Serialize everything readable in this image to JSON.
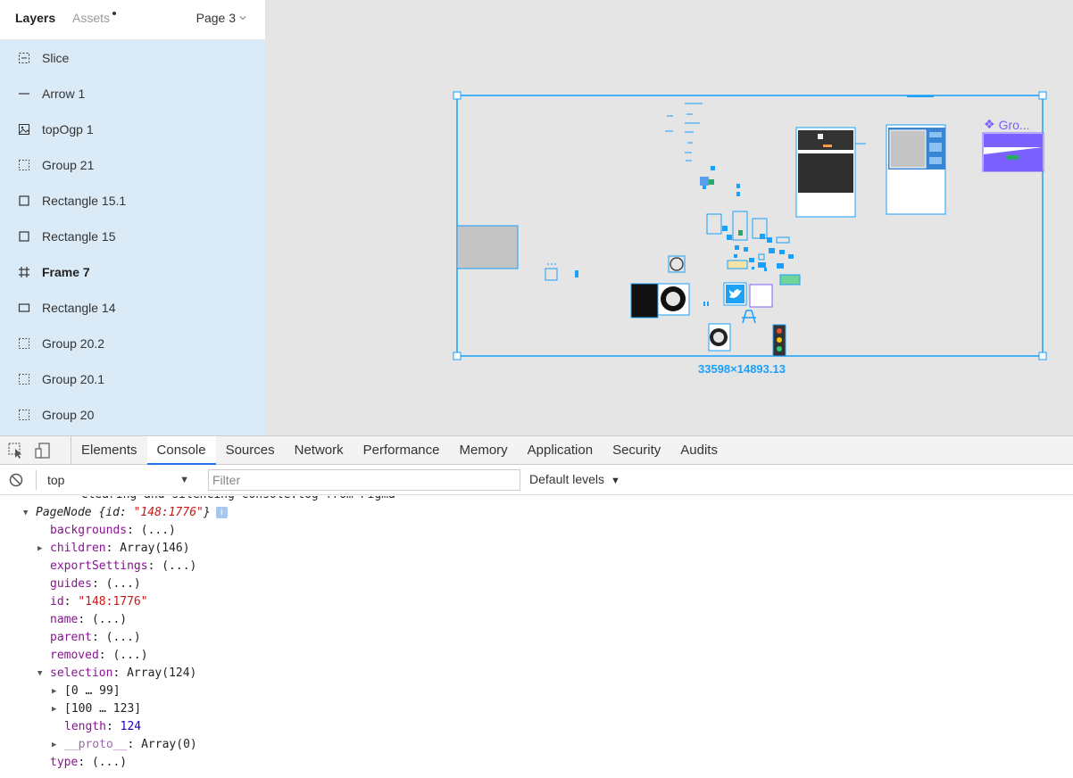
{
  "figma": {
    "tabs": {
      "layers": "Layers",
      "assets": "Assets"
    },
    "page_selector": "Page 3",
    "layers": [
      {
        "name": "Slice",
        "icon": "slice-icon",
        "kind": "slice"
      },
      {
        "name": "Arrow 1",
        "icon": "line-icon",
        "kind": "line"
      },
      {
        "name": "topOgp 1",
        "icon": "image-icon",
        "kind": "image"
      },
      {
        "name": "Group 21",
        "icon": "group-icon",
        "kind": "group"
      },
      {
        "name": "Rectangle 15.1",
        "icon": "rectangle-icon",
        "kind": "rect"
      },
      {
        "name": "Rectangle 15",
        "icon": "rectangle-icon",
        "kind": "rect"
      },
      {
        "name": "Frame 7",
        "icon": "frame-icon",
        "kind": "frame"
      },
      {
        "name": "Rectangle 14",
        "icon": "rectangle-icon",
        "kind": "rect-wide"
      },
      {
        "name": "Group 20.2",
        "icon": "group-icon",
        "kind": "group"
      },
      {
        "name": "Group 20.1",
        "icon": "group-icon",
        "kind": "group"
      },
      {
        "name": "Group 20",
        "icon": "group-icon",
        "kind": "group"
      }
    ],
    "canvas": {
      "dimension_label": "33598×14893.13",
      "group_label": "Gro..."
    },
    "colors": {
      "selection": "#18a0fb",
      "component": "#7b61ff",
      "layer_list_bg": "#daeaf7"
    }
  },
  "devtools": {
    "tabs": [
      "Elements",
      "Console",
      "Sources",
      "Network",
      "Performance",
      "Memory",
      "Application",
      "Security",
      "Audits"
    ],
    "active_tab": "Console",
    "context": "top",
    "filter_placeholder": "Filter",
    "levels": "Default levels",
    "console": {
      "clipped_line": "------- Clearing and silencing console.log from Figma -------",
      "root_label": "PageNode",
      "root_id_key": "id",
      "root_id_value": "\"148:1776\"",
      "info_badge": "i",
      "props": [
        {
          "key": "backgrounds",
          "value": "(...)",
          "expandable": false,
          "expanded": false
        },
        {
          "key": "children",
          "value": "Array(146)",
          "expandable": true,
          "expanded": false
        },
        {
          "key": "exportSettings",
          "value": "(...)",
          "expandable": false,
          "expanded": false
        },
        {
          "key": "guides",
          "value": "(...)",
          "expandable": false,
          "expanded": false
        },
        {
          "key": "id",
          "value": "\"148:1776\"",
          "expandable": false,
          "expanded": false,
          "type": "string"
        },
        {
          "key": "name",
          "value": "(...)",
          "expandable": false,
          "expanded": false
        },
        {
          "key": "parent",
          "value": "(...)",
          "expandable": false,
          "expanded": false
        },
        {
          "key": "removed",
          "value": "(...)",
          "expandable": false,
          "expanded": false
        },
        {
          "key": "selection",
          "value": "Array(124)",
          "expandable": true,
          "expanded": true
        }
      ],
      "selection_children": [
        {
          "label": "[0 … 99]",
          "expandable": true
        },
        {
          "label": "[100 … 123]",
          "expandable": true
        },
        {
          "key": "length",
          "value": "124",
          "expandable": false
        },
        {
          "key": "__proto__",
          "value": "Array(0)",
          "expandable": true
        }
      ],
      "last_prop": {
        "key": "type",
        "value": "(...)"
      }
    }
  }
}
